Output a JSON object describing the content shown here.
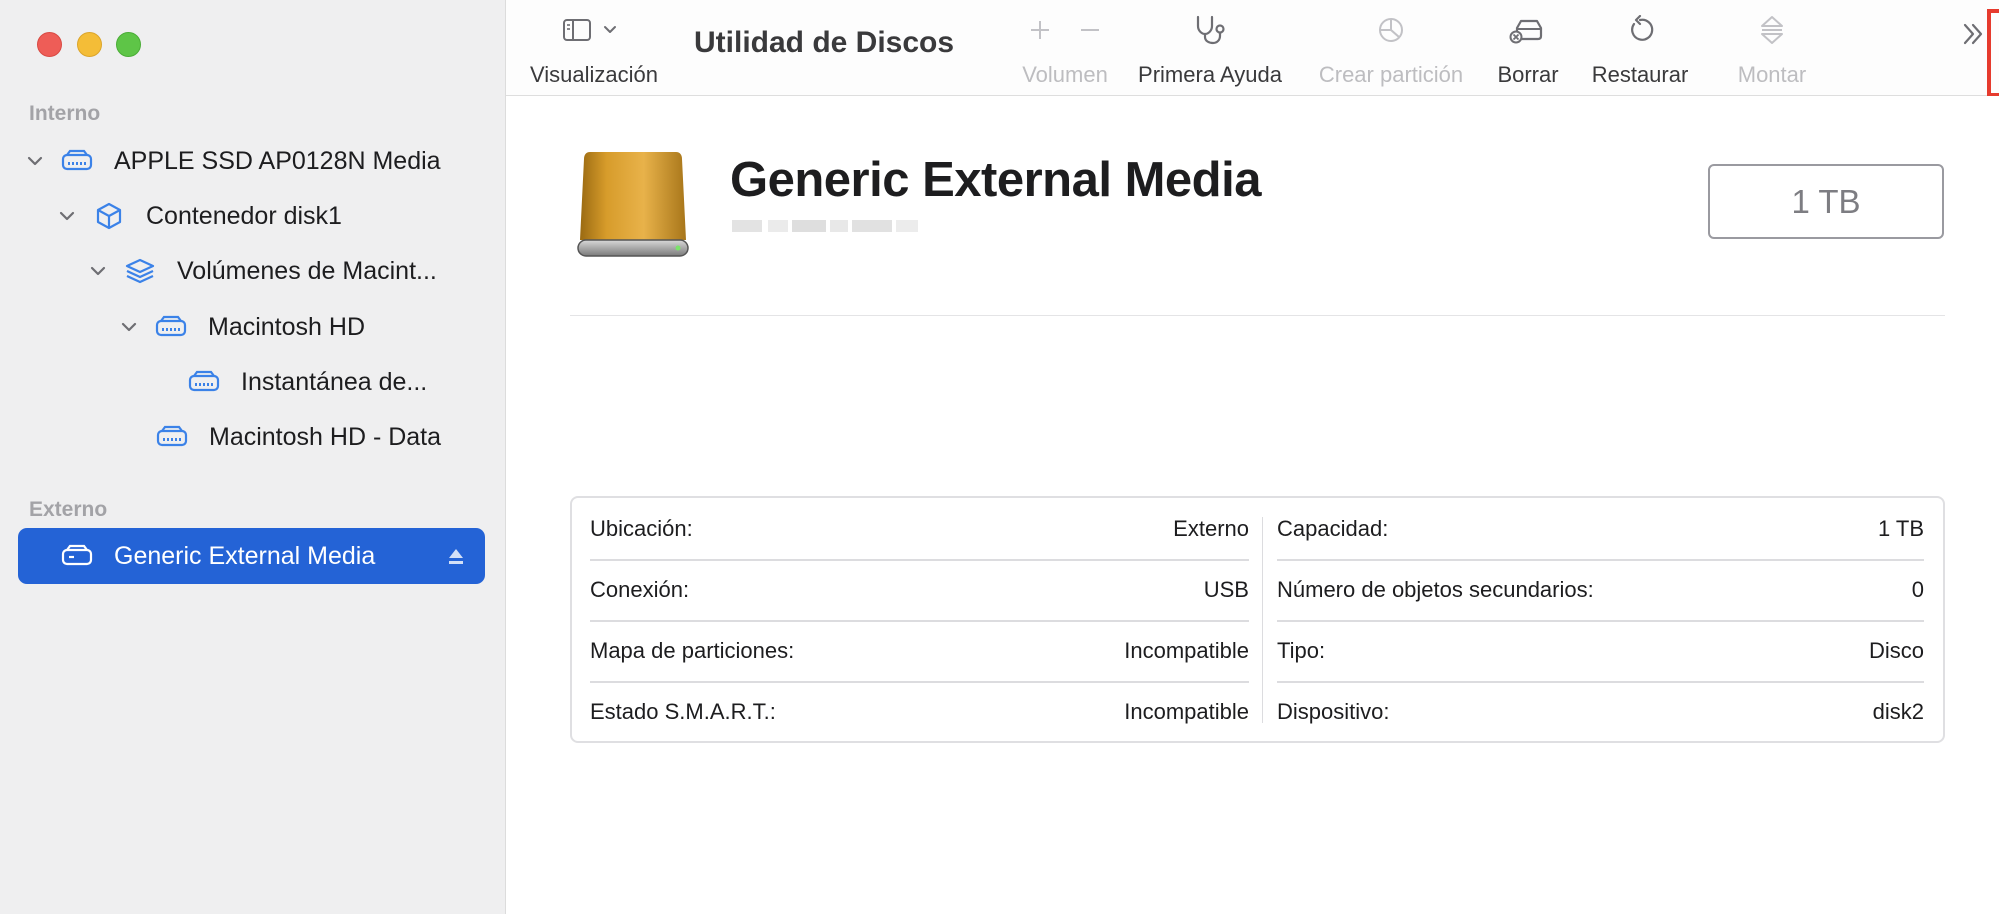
{
  "window": {
    "title": "Utilidad de Discos"
  },
  "sidebar": {
    "sections": [
      {
        "title": "Interno"
      },
      {
        "title": "Externo"
      }
    ],
    "items": [
      {
        "label": "APPLE SSD AP0128N Media"
      },
      {
        "label": "Contenedor disk1"
      },
      {
        "label": "Volúmenes de Macint..."
      },
      {
        "label": "Macintosh HD"
      },
      {
        "label": "Instantánea de..."
      },
      {
        "label": "Macintosh HD - Data"
      },
      {
        "label": "Generic External Media"
      }
    ]
  },
  "toolbar": {
    "view_label": "Visualización",
    "volume_label": "Volumen",
    "first_aid_label": "Primera Ayuda",
    "partition_label": "Crear partición",
    "erase_label": "Borrar",
    "restore_label": "Restaurar",
    "mount_label": "Montar"
  },
  "disk": {
    "name": "Generic External Media",
    "capacity": "1 TB"
  },
  "info": {
    "left": [
      {
        "key": "Ubicación:",
        "value": "Externo"
      },
      {
        "key": "Conexión:",
        "value": "USB"
      },
      {
        "key": "Mapa de particiones:",
        "value": "Incompatible"
      },
      {
        "key": "Estado S.M.A.R.T.:",
        "value": "Incompatible"
      }
    ],
    "right": [
      {
        "key": "Capacidad:",
        "value": "1 TB"
      },
      {
        "key": "Número de objetos secundarios:",
        "value": "0"
      },
      {
        "key": "Tipo:",
        "value": "Disco"
      },
      {
        "key": "Dispositivo:",
        "value": "disk2"
      }
    ]
  },
  "colors": {
    "accent": "#2463d6",
    "highlight": "#e63b2e",
    "sidebar_icon": "#3b82e8"
  },
  "icons": {
    "drive": "internal-drive-icon",
    "container": "container-cube-icon",
    "volumes": "stacked-layers-icon",
    "external": "external-drive-icon",
    "eject": "eject-icon"
  }
}
